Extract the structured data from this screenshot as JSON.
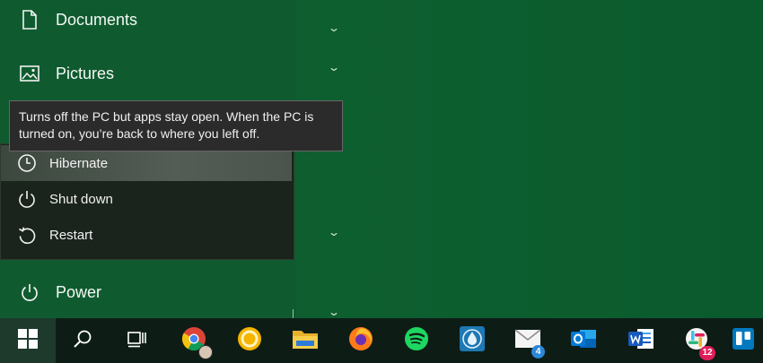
{
  "start_menu": {
    "documents_label": "Documents",
    "pictures_label": "Pictures",
    "power_label": "Power"
  },
  "power_menu": {
    "items": [
      {
        "label": "Hibernate",
        "icon": "clock-icon",
        "highlighted": true
      },
      {
        "label": "Shut down",
        "icon": "power-icon"
      },
      {
        "label": "Restart",
        "icon": "restart-icon"
      }
    ]
  },
  "tooltip": {
    "line1": "Turns off the PC but apps stay open. When the PC is",
    "line2": "turned on, you’re back to where you left off."
  },
  "taskbar": {
    "items": [
      {
        "icon": "windows-start-icon"
      },
      {
        "icon": "search-icon"
      },
      {
        "icon": "task-view-icon"
      },
      {
        "icon": "chrome-icon"
      },
      {
        "icon": "yellow-circle-app-icon"
      },
      {
        "icon": "file-explorer-icon"
      },
      {
        "icon": "firefox-icon"
      },
      {
        "icon": "spotify-icon"
      },
      {
        "icon": "droplet-app-icon"
      },
      {
        "icon": "mail-icon",
        "badge": "4"
      },
      {
        "icon": "outlook-icon"
      },
      {
        "icon": "word-icon"
      },
      {
        "icon": "slack-icon",
        "badge": "12"
      },
      {
        "icon": "trello-icon"
      }
    ]
  },
  "colors": {
    "desktop": "#0c5a2d",
    "taskbar": "#0d1d16",
    "menu_bg": "#1a241c",
    "tooltip_bg": "#2b2b2b"
  }
}
